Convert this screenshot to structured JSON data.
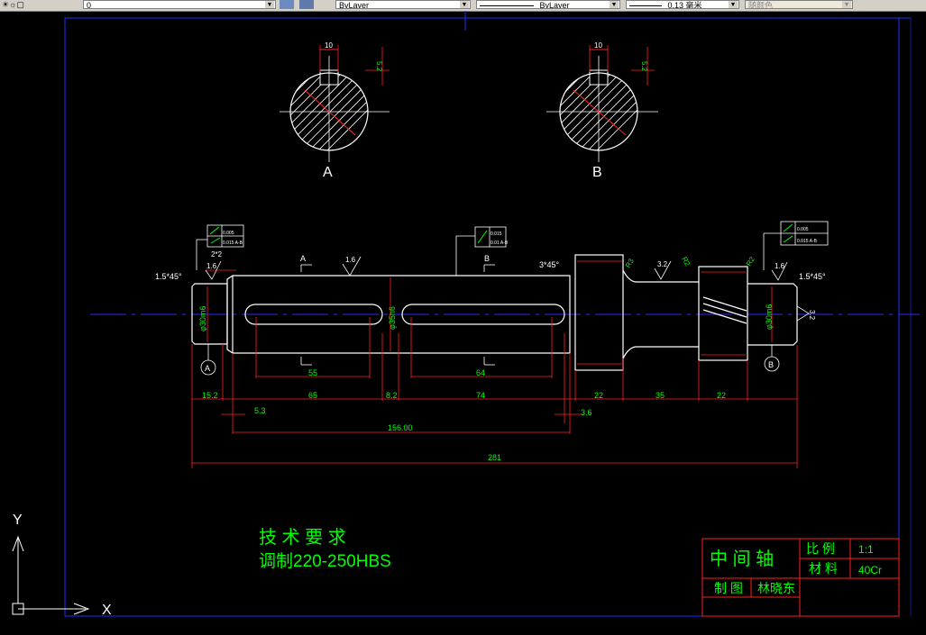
{
  "toolbar": {
    "layer_value": "0",
    "color_value": "ByLayer",
    "linetype_value": "ByLayer",
    "lineweight_value": "0.13 毫米",
    "plotstyle_value": "随颜色"
  },
  "drawing": {
    "section_a_label": "A",
    "section_b_label": "B",
    "section_a_width": "10",
    "section_a_depth": "5.2",
    "section_b_width": "10",
    "section_b_depth": "5.2",
    "roughness_values": [
      "1.6",
      "1.6",
      "3.2",
      "1.6",
      "3.2"
    ],
    "chamfer_left": "1.5*45°",
    "chamfer_right": "1.5*45°",
    "chamfer_mid": "3*45°",
    "fit_left": "2*2",
    "dia_left": "φ30m6",
    "dia_mid": "φ35h6",
    "dia_right": "φ30m6",
    "radius_labels": [
      "R3",
      "R2",
      "R2"
    ],
    "datum_a": "A",
    "datum_b": "B",
    "tol_left": [
      "0.005",
      "0.015 A-B"
    ],
    "tol_mid": [
      "0.015",
      "0.01 A-B"
    ],
    "tol_right": [
      "0.005",
      "0.015 A-B"
    ],
    "dims_row1": [
      "55",
      "64"
    ],
    "dims_row2": [
      "15.2",
      "65",
      "8.2",
      "74",
      "22",
      "35",
      "22"
    ],
    "dims_row3": [
      "5.3",
      "3.6"
    ],
    "dim_156": "156.00",
    "dim_281": "281",
    "section_arrow_a": "A",
    "section_arrow_b": "B"
  },
  "notes": {
    "title": "技 术 要 求",
    "line1": "调制220-250HBS"
  },
  "title_block": {
    "part_name": "中 间 轴",
    "scale_label": "比 例",
    "scale_value": "1:1",
    "material_label": "材 料",
    "material_value": "40Cr",
    "drawn_label": "制 图",
    "drawn_value": "林晓东"
  },
  "ucs": {
    "x_label": "X",
    "y_label": "Y"
  }
}
